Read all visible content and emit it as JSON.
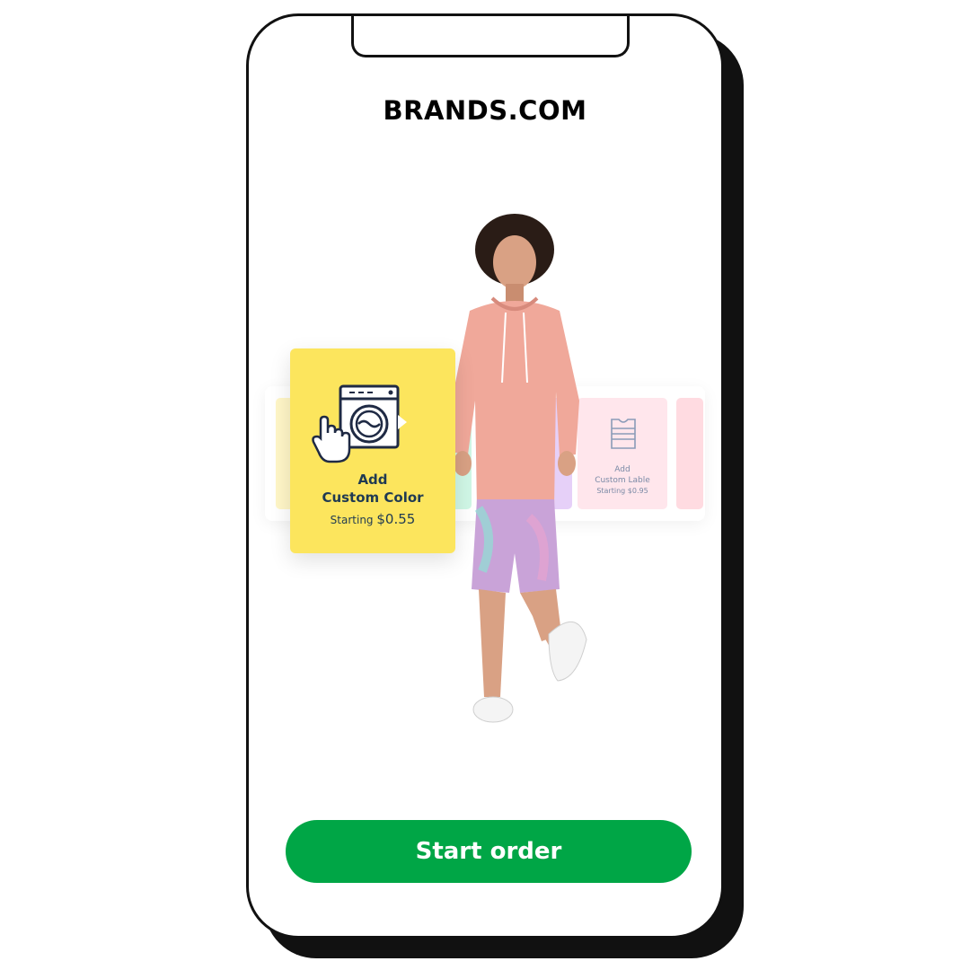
{
  "app": {
    "brand": "BRANDS.COM"
  },
  "hero": {
    "focused_card": {
      "icon": "washing-machine-icon",
      "cursor_icon": "hand-pointer-icon",
      "title_line1": "Add",
      "title_line2": "Custom Color",
      "price_prefix": "Starting",
      "price_value": "$0.55",
      "background": "#fce55d"
    },
    "faded_cards": [
      {
        "icon": "shirt-tag-icon",
        "title_line1": "Add",
        "title_line2": "Custom Lable",
        "price_prefix": "Starting",
        "price_value": "$0.95"
      }
    ],
    "model": "person-in-pink-hoodie-image"
  },
  "actions": {
    "start_order_label": "Start order"
  },
  "colors": {
    "accent": "#00a646",
    "card_text": "#1f3a52",
    "frame": "#111111"
  }
}
